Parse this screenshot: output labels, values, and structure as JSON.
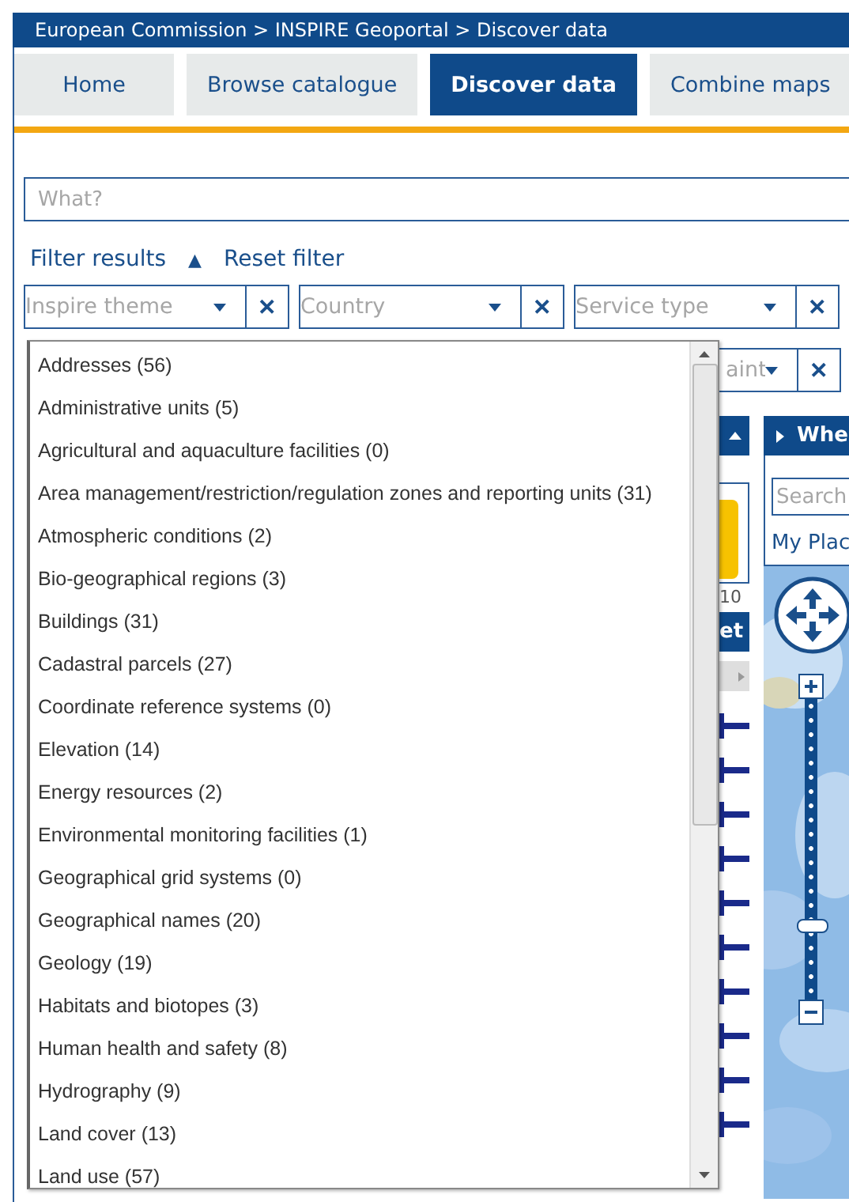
{
  "breadcrumb": "European Commission > INSPIRE Geoportal > Discover data",
  "tabs": [
    {
      "label": "Home",
      "selected": false
    },
    {
      "label": "Browse catalogue",
      "selected": false
    },
    {
      "label": "Discover data",
      "selected": true
    },
    {
      "label": "Combine maps",
      "selected": false
    }
  ],
  "search": {
    "placeholder": "What?"
  },
  "filter": {
    "label": "Filter results",
    "toggle": "▲",
    "reset": "Reset filter",
    "expanded": true
  },
  "filters": [
    {
      "placeholder": "Inspire theme",
      "clear": "✕"
    },
    {
      "placeholder": "Country",
      "clear": "✕"
    },
    {
      "placeholder": "Service type",
      "clear": "✕"
    }
  ],
  "filter_row_2": [
    {
      "placeholder": "aint",
      "clear": "✕"
    }
  ],
  "dropdown": {
    "items": [
      "Addresses (56)",
      "Administrative units (5)",
      "Agricultural and aquaculture facilities (0)",
      "Area management/restriction/regulation zones and reporting units (31)",
      "Atmospheric conditions (2)",
      "Bio-geographical regions (3)",
      "Buildings (31)",
      "Cadastral parcels (27)",
      "Coordinate reference systems (0)",
      "Elevation (14)",
      "Energy resources (2)",
      "Environmental monitoring facilities (1)",
      "Geographical grid systems (0)",
      "Geographical names (20)",
      "Geology (19)",
      "Habitats and biotopes (3)",
      "Human health and safety (8)",
      "Hydrography (9)",
      "Land cover (13)",
      "Land use (57)"
    ]
  },
  "middle_panel": {
    "count": "10",
    "header": "et"
  },
  "where_panel": {
    "title": "Whe",
    "search_placeholder": "Search",
    "link": "My Plac",
    "zoom": {
      "level": 0.22
    }
  }
}
